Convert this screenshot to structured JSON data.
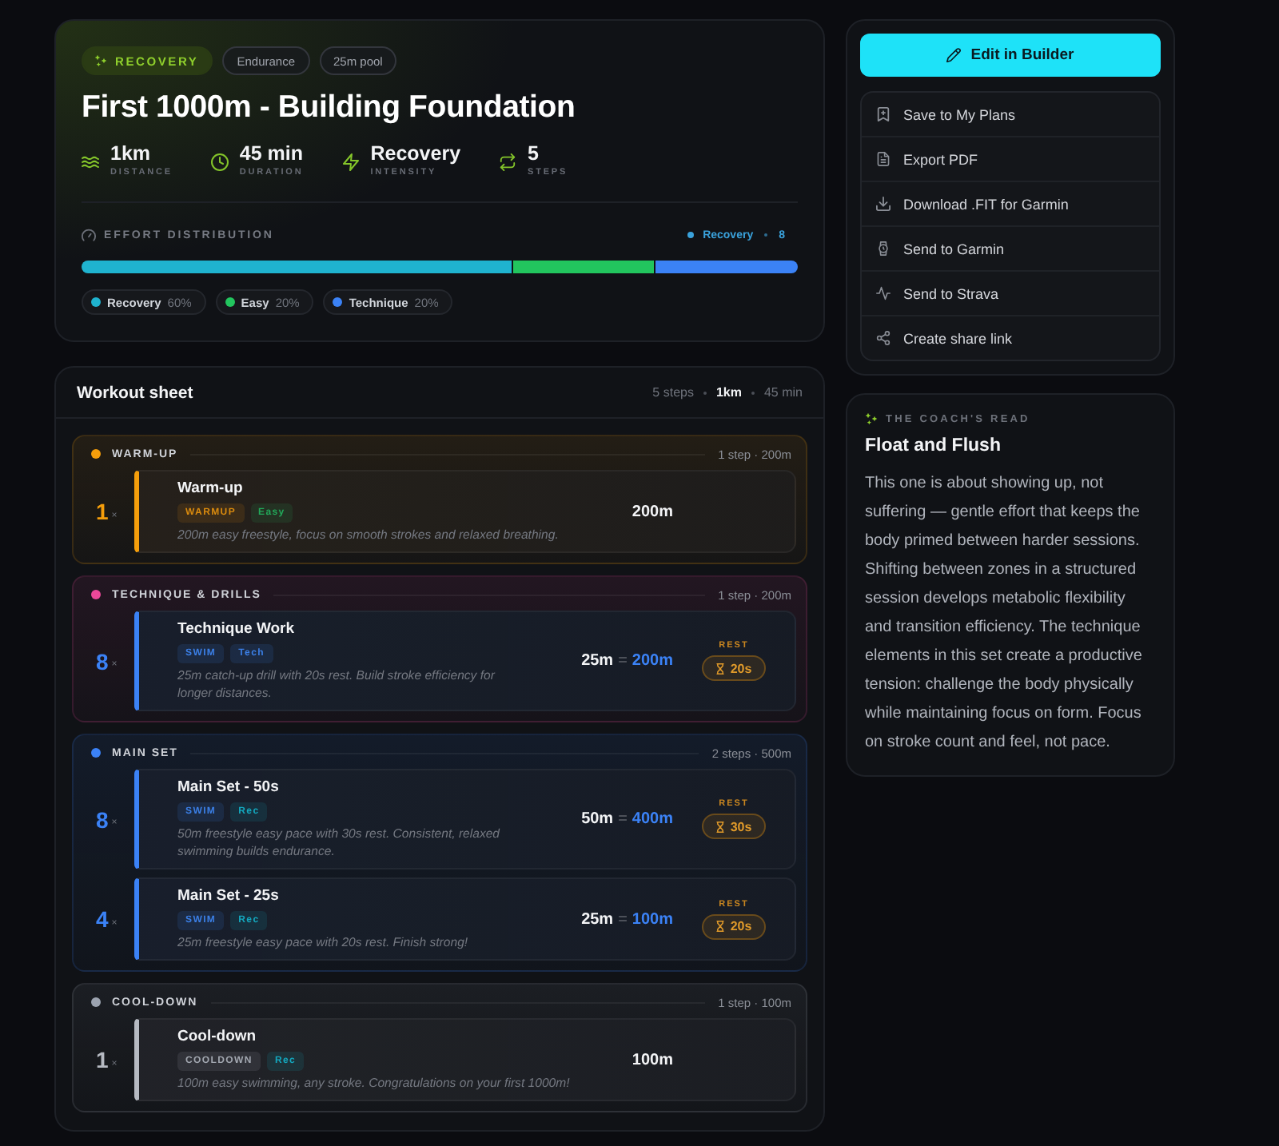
{
  "hero": {
    "tags": [
      {
        "label": "RECOVERY",
        "kind": "highlight"
      },
      {
        "label": "Endurance",
        "kind": "plain"
      },
      {
        "label": "25m pool",
        "kind": "plain"
      }
    ],
    "title": "First 1000m - Building Foundation",
    "stats": [
      {
        "kind": "distance",
        "value": "1km",
        "label": "DISTANCE"
      },
      {
        "kind": "duration",
        "value": "45 min",
        "label": "DURATION"
      },
      {
        "kind": "intensity",
        "value": "Recovery",
        "label": "INTENSITY"
      },
      {
        "kind": "steps",
        "value": "5",
        "label": "STEPS"
      }
    ],
    "effort": {
      "title": "EFFORT DISTRIBUTION",
      "current": {
        "label": "Recovery",
        "count": "8"
      },
      "segments": [
        {
          "label": "Recovery",
          "percent": "60%",
          "color": "#1fb3cf"
        },
        {
          "label": "Easy",
          "percent": "20%",
          "color": "#22c55e"
        },
        {
          "label": "Technique",
          "percent": "20%",
          "color": "#3b82f6"
        }
      ]
    }
  },
  "sheet": {
    "title": "Workout sheet",
    "summary": {
      "steps": "5 steps",
      "distance": "1km",
      "duration": "45 min"
    },
    "sections": [
      {
        "name": "WARM-UP",
        "color": "#f59e0b",
        "summary": "1 step · 200m",
        "steps": [
          {
            "reps": "1",
            "times": "×",
            "color": "#f59e0b",
            "title": "Warm-up",
            "tags": [
              {
                "label": "WARMUP",
                "color": "#d98a0e"
              },
              {
                "label": "Easy",
                "color": "#22a95a"
              }
            ],
            "description": "200m easy freestyle, focus on smooth strokes and relaxed breathing.",
            "distance": "200m"
          }
        ]
      },
      {
        "name": "TECHNIQUE & DRILLS",
        "color": "#ec4899",
        "summary": "1 step · 200m",
        "steps": [
          {
            "reps": "8",
            "times": "×",
            "color": "#3b82f6",
            "title": "Technique Work",
            "tags": [
              {
                "label": "SWIM",
                "color": "#3b7fe6"
              },
              {
                "label": "Tech",
                "color": "#3b7fe6"
              }
            ],
            "description": "25m catch-up drill with 20s rest. Build stroke efficiency for longer distances.",
            "distance": "25m",
            "equals": "=",
            "total": "200m",
            "rest": {
              "label": "REST",
              "value": "20s"
            }
          }
        ]
      },
      {
        "name": "MAIN SET",
        "color": "#3b82f6",
        "summary": "2 steps · 500m",
        "steps": [
          {
            "reps": "8",
            "times": "×",
            "color": "#3b82f6",
            "title": "Main Set - 50s",
            "tags": [
              {
                "label": "SWIM",
                "color": "#3b7fe6"
              },
              {
                "label": "Rec",
                "color": "#14a8bf"
              }
            ],
            "description": "50m freestyle easy pace with 30s rest. Consistent, relaxed swimming builds endurance.",
            "distance": "50m",
            "equals": "=",
            "total": "400m",
            "rest": {
              "label": "REST",
              "value": "30s"
            }
          },
          {
            "reps": "4",
            "times": "×",
            "color": "#3b82f6",
            "title": "Main Set - 25s",
            "tags": [
              {
                "label": "SWIM",
                "color": "#3b7fe6"
              },
              {
                "label": "Rec",
                "color": "#14a8bf"
              }
            ],
            "description": "25m freestyle easy pace with 20s rest. Finish strong!",
            "distance": "25m",
            "equals": "=",
            "total": "100m",
            "rest": {
              "label": "REST",
              "value": "20s"
            }
          }
        ]
      },
      {
        "name": "COOL-DOWN",
        "color": "#9ca3af",
        "summary": "1 step · 100m",
        "steps": [
          {
            "reps": "1",
            "times": "×",
            "color": "#b6bac2",
            "title": "Cool-down",
            "tags": [
              {
                "label": "COOLDOWN",
                "color": "#a3a8b1"
              },
              {
                "label": "Rec",
                "color": "#14a8bf"
              }
            ],
            "description": "100m easy swimming, any stroke. Congratulations on your first 1000m!",
            "distance": "100m"
          }
        ]
      }
    ]
  },
  "actions": {
    "primary": {
      "label": "Edit in Builder"
    },
    "items": [
      {
        "kind": "bookmark",
        "label": "Save to My Plans"
      },
      {
        "kind": "document",
        "label": "Export PDF"
      },
      {
        "kind": "download",
        "label": "Download .FIT for Garmin"
      },
      {
        "kind": "watch",
        "label": "Send to Garmin"
      },
      {
        "kind": "pulse",
        "label": "Send to Strava"
      },
      {
        "kind": "share",
        "label": "Create share link"
      }
    ]
  },
  "coach": {
    "eyebrow": "THE COACH'S READ",
    "title": "Float and Flush",
    "body": "This one is about showing up, not suffering — gentle effort that keeps the body primed between harder sessions. Shifting between zones in a structured session develops metabolic flexibility and transition efficiency. The technique elements in this set create a productive tension: challenge the body physically while maintaining focus on form. Focus on stroke count and feel, not pace."
  }
}
